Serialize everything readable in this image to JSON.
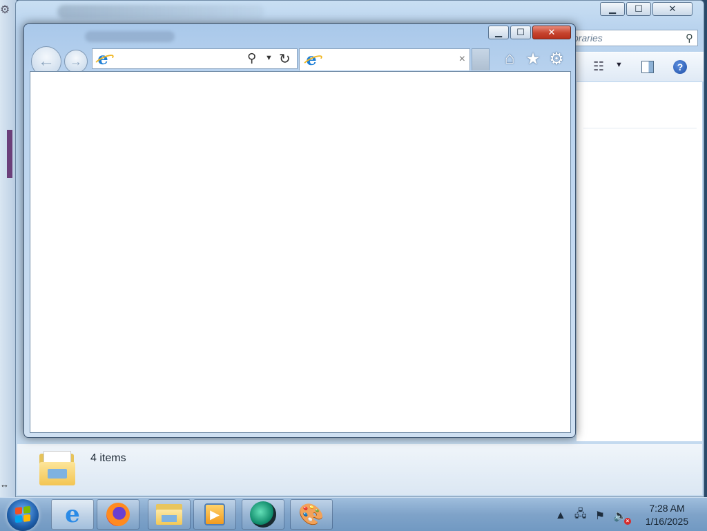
{
  "explorer": {
    "search_placeholder": "braries",
    "status": {
      "items_count": "4 items"
    },
    "window_controls": {
      "minimize": "▁",
      "maximize": "☐",
      "close": "✕"
    }
  },
  "ie": {
    "window_controls": {
      "minimize": "▁",
      "maximize": "☐",
      "close": "✕"
    },
    "address": {
      "value": ""
    },
    "tab": {
      "title": "",
      "close": "×"
    },
    "tools": {
      "home": "⌂",
      "favorites": "★",
      "settings": "⚙"
    }
  },
  "taskbar": {
    "apps": [
      {
        "name": "Internet Explorer",
        "icon": "ie-icon",
        "active": true
      },
      {
        "name": "Firefox",
        "icon": "firefox-icon"
      },
      {
        "name": "Windows Explorer",
        "icon": "folder-icon"
      },
      {
        "name": "Media Player",
        "icon": "media-player-icon"
      },
      {
        "name": "Green app",
        "icon": "green-app-icon"
      },
      {
        "name": "Paint",
        "icon": "paint-icon"
      }
    ],
    "clock": {
      "time": "7:28 AM",
      "date": "1/16/2025"
    }
  },
  "colors": {
    "taskbar": "#7fa3c9",
    "ie_frame": "#b8d2ee",
    "close_red": "#c6442e"
  }
}
